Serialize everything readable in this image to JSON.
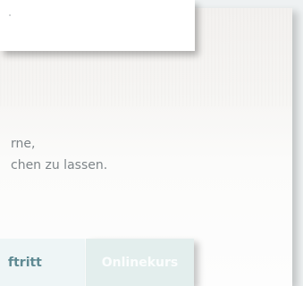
{
  "card": {
    "mark": "ᵒ"
  },
  "content": {
    "lines": [
      "rne,",
      "chen zu lassen."
    ]
  },
  "buttons": {
    "auftritt_label": "ftritt",
    "onlinekurs_label": "Onlinekurs"
  },
  "colors": {
    "background": "#eef1f2",
    "text": "#7e8589",
    "button_teal_text": "#5f8a93",
    "button_light_bg": "#eef5f6",
    "button_mint_bg": "#e3eeed"
  }
}
